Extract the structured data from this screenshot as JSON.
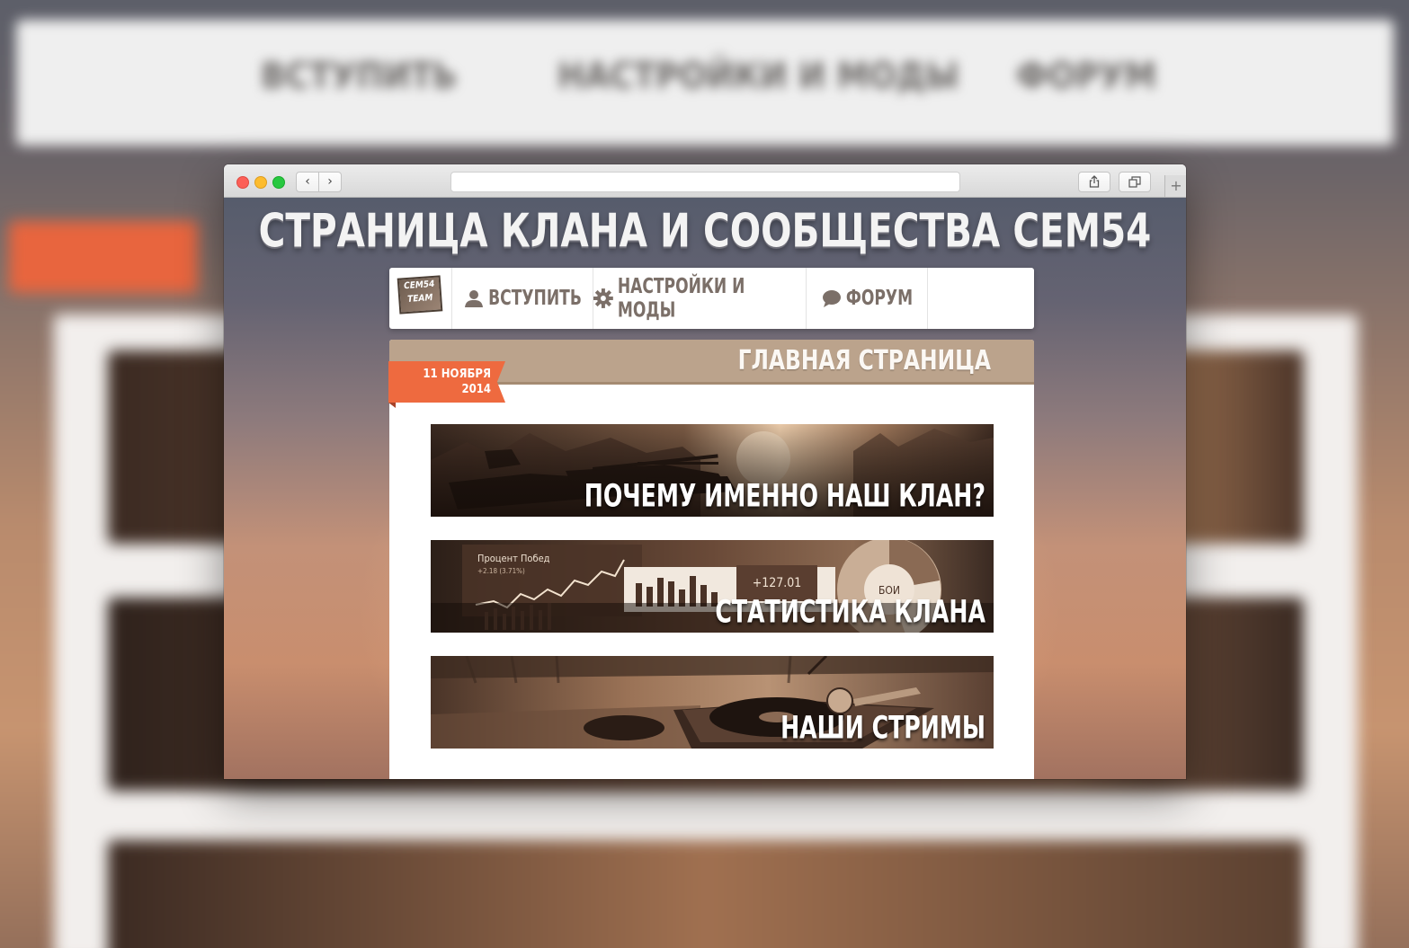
{
  "page": {
    "title": "СТРАНИЦА КЛАНА И СООБЩЕСТВА CEM54"
  },
  "logo": {
    "line1": "CEM54",
    "line2": "TEAM"
  },
  "menu": {
    "items": [
      {
        "label": "ВСТУПИТЬ",
        "icon": "user-icon"
      },
      {
        "label": "НАСТРОЙКИ И МОДЫ",
        "icon": "gear-icon"
      },
      {
        "label": "ФОРУМ",
        "icon": "speech-bubble-icon"
      }
    ]
  },
  "panel": {
    "title": "ГЛАВНАЯ СТРАНИЦА",
    "date_line1": "11 НОЯБРЯ",
    "date_line2": "2014"
  },
  "banners": [
    {
      "label": "ПОЧЕМУ ИМЕННО НАШ КЛАН?"
    },
    {
      "label": "СТАТИСТИКА КЛАНА",
      "graphic_texts": [
        "Процент Побед",
        "+2.18 (3.71%)",
        "+127.01",
        "БОИ"
      ]
    },
    {
      "label": "НАШИ СТРИМЫ"
    }
  ],
  "colors": {
    "accent_orange": "#ee6a3f",
    "panel_header": "#bba38c",
    "menu_text": "#7b6f68",
    "banner_sepia": "#3d2b21"
  }
}
